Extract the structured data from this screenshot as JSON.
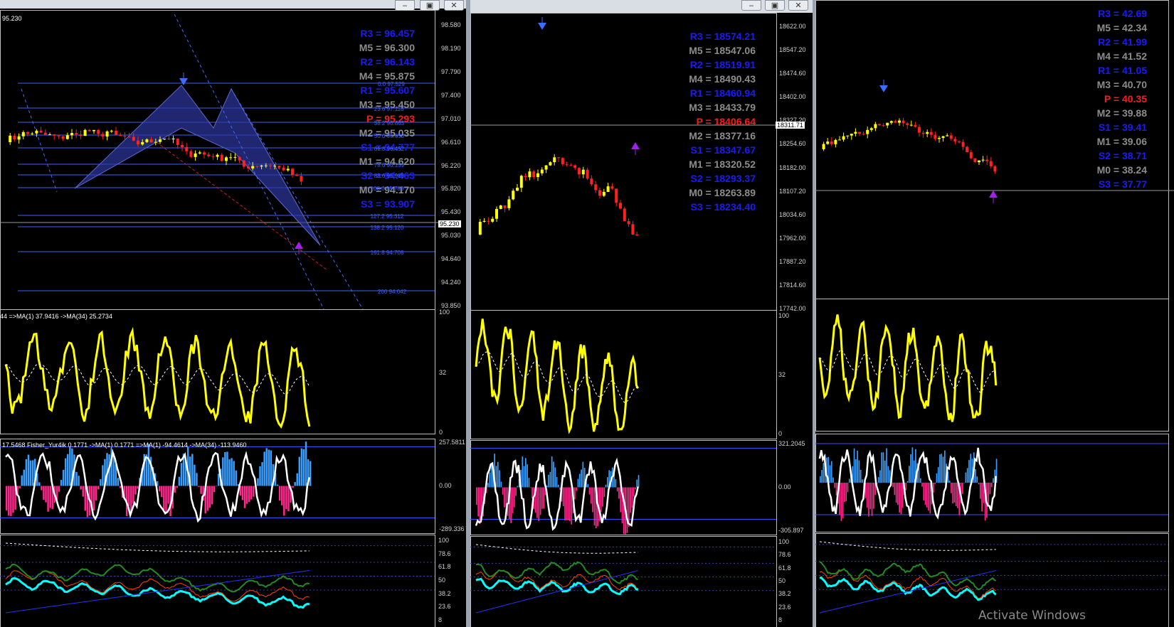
{
  "windows": [
    {
      "id": "w1",
      "top_label": "95.230",
      "price_axis": [
        "98.580",
        "98.190",
        "97.790",
        "97.400",
        "97.010",
        "96.610",
        "96.220",
        "95.820",
        "95.430",
        "95.030",
        "94.640",
        "94.240",
        "93.850"
      ],
      "current_price": "95.230",
      "pivots": [
        {
          "label": "R3 = 96.457",
          "color": "#1a1aff"
        },
        {
          "label": "M5 = 96.300",
          "color": "#8c8c8c"
        },
        {
          "label": "R2 = 96.143",
          "color": "#1a1aff"
        },
        {
          "label": "M4 = 95.875",
          "color": "#8c8c8c"
        },
        {
          "label": "R1 = 95.607",
          "color": "#1a1aff"
        },
        {
          "label": "M3 = 95.450",
          "color": "#8c8c8c"
        },
        {
          "label": "P  = 95.293",
          "color": "#ff1a1a"
        },
        {
          "label": "M2 = 95.035",
          "color": "#8c8c8c"
        },
        {
          "label": "S1 = 94.777",
          "color": "#1a1aff"
        },
        {
          "label": "M1 = 94.620",
          "color": "#8c8c8c"
        },
        {
          "label": "S2 = 94.463",
          "color": "#1a1aff"
        },
        {
          "label": "M0 = 94.170",
          "color": "#8c8c8c"
        },
        {
          "label": "S3 = 93.907",
          "color": "#1a1aff"
        }
      ],
      "fib_levels": [
        "0.0 97.529",
        "23.6 97.118",
        "38.2 96.863",
        "50.0 96.658",
        "61.8 96.452",
        "78.6 96.159",
        "88.6 95.985",
        "100.0 95.786",
        "127.2 95.312",
        "138.2 95.120",
        "161.8 94.708",
        "200 94.042"
      ],
      "rsi_label": "44 =>MA(1) 37.9416 ->MA(34) 25.2734",
      "rsi_axis": [
        "100",
        "32",
        "0"
      ],
      "fisher_label": "17.5468 Fisher_Yur4ik 0.1771 ->MA(1) 0.1771 =>MA(1) -94.4614 ->MA(34) -113.9460",
      "fisher_axis": [
        "257.5811",
        "0.00",
        "-289.336"
      ],
      "stoch_axis": [
        "100",
        "78.6",
        "61.8",
        "50",
        "38.2",
        "23.6",
        "8"
      ]
    },
    {
      "id": "w2",
      "price_axis": [
        "18622.00",
        "18547.20",
        "18474.60",
        "18402.00",
        "18327.20",
        "18254.60",
        "18182.00",
        "18107.20",
        "18034.60",
        "17962.00",
        "17887.20",
        "17814.60",
        "17742.00"
      ],
      "current_price": "18311.71",
      "pivots": [
        {
          "label": "R3 = 18574.21",
          "color": "#1a1aff"
        },
        {
          "label": "M5 = 18547.06",
          "color": "#8c8c8c"
        },
        {
          "label": "R2 = 18519.91",
          "color": "#1a1aff"
        },
        {
          "label": "M4 = 18490.43",
          "color": "#8c8c8c"
        },
        {
          "label": "R1 = 18460.94",
          "color": "#1a1aff"
        },
        {
          "label": "M3 = 18433.79",
          "color": "#8c8c8c"
        },
        {
          "label": "P  = 18406.64",
          "color": "#ff1a1a"
        },
        {
          "label": "M2 = 18377.16",
          "color": "#8c8c8c"
        },
        {
          "label": "S1 = 18347.67",
          "color": "#1a1aff"
        },
        {
          "label": "M1 = 18320.52",
          "color": "#8c8c8c"
        },
        {
          "label": "S2 = 18293.37",
          "color": "#1a1aff"
        },
        {
          "label": "M0 = 18263.89",
          "color": "#8c8c8c"
        },
        {
          "label": "S3 = 18234.40",
          "color": "#1a1aff"
        }
      ],
      "rsi_axis": [
        "100",
        "32",
        "0"
      ],
      "fisher_axis": [
        "321.2045",
        "0.00",
        "-305.897"
      ],
      "stoch_axis": [
        "100",
        "78.6",
        "61.8",
        "50",
        "38.2",
        "23.6",
        "8"
      ]
    },
    {
      "id": "w3",
      "pivots": [
        {
          "label": "R3 = 42.69",
          "color": "#1a1aff"
        },
        {
          "label": "M5 = 42.34",
          "color": "#8c8c8c"
        },
        {
          "label": "R2 = 41.99",
          "color": "#1a1aff"
        },
        {
          "label": "M4 = 41.52",
          "color": "#8c8c8c"
        },
        {
          "label": "R1 = 41.05",
          "color": "#1a1aff"
        },
        {
          "label": "M3 = 40.70",
          "color": "#8c8c8c"
        },
        {
          "label": "P  = 40.35",
          "color": "#ff1a1a"
        },
        {
          "label": "M2 = 39.88",
          "color": "#8c8c8c"
        },
        {
          "label": "S1 = 39.41",
          "color": "#1a1aff"
        },
        {
          "label": "M1 = 39.06",
          "color": "#8c8c8c"
        },
        {
          "label": "S2 = 38.71",
          "color": "#1a1aff"
        },
        {
          "label": "M0 = 38.24",
          "color": "#8c8c8c"
        },
        {
          "label": "S3 = 37.77",
          "color": "#1a1aff"
        }
      ]
    }
  ],
  "window_controls": {
    "minimize": "‒",
    "maximize": "▣",
    "close": "✕"
  },
  "watermark": "Activate Windows"
}
